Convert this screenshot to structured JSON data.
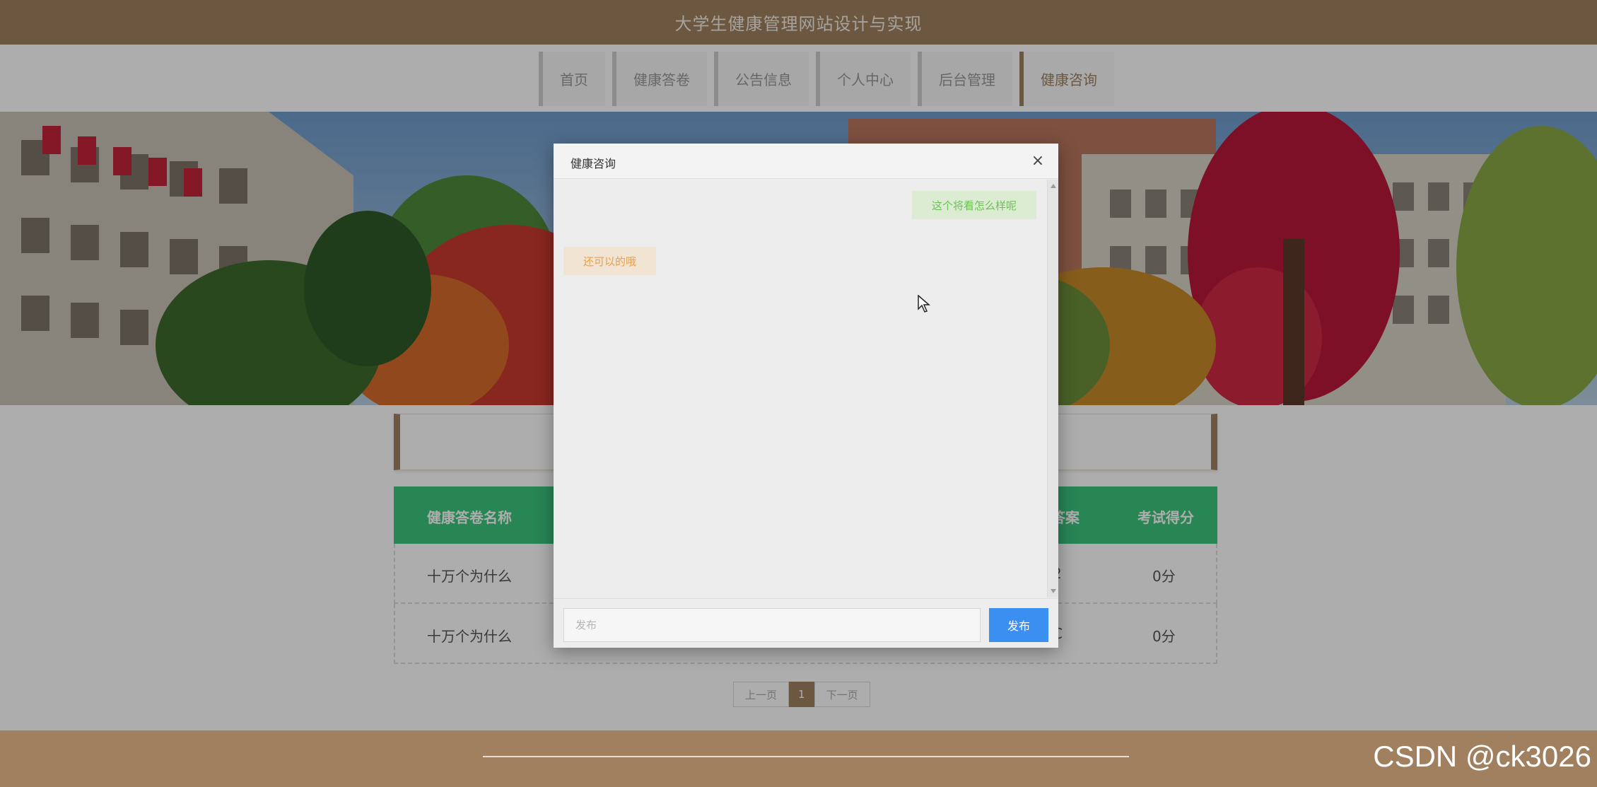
{
  "header": {
    "site_title": "大学生健康管理网站设计与实现"
  },
  "nav": {
    "items": [
      {
        "label": "首页",
        "active": false
      },
      {
        "label": "健康答卷",
        "active": false
      },
      {
        "label": "公告信息",
        "active": false
      },
      {
        "label": "个人中心",
        "active": false
      },
      {
        "label": "后台管理",
        "active": false
      },
      {
        "label": "健康咨询",
        "active": true
      }
    ]
  },
  "table": {
    "headers": {
      "name": "健康答卷名称",
      "answer": "答案",
      "score": "考试得分"
    },
    "rows": [
      {
        "name": "十万个为什么",
        "answer": "2",
        "score": "0分"
      },
      {
        "name": "十万个为什么",
        "answer": "C",
        "score": "0分"
      }
    ]
  },
  "pager": {
    "prev": "上一页",
    "current": "1",
    "next": "下一页"
  },
  "dialog": {
    "title": "健康咨询",
    "close": "×",
    "messages": {
      "sent": "这个将看怎么样呢",
      "received": "还可以的哦"
    },
    "input_placeholder": "发布",
    "send_label": "发布"
  },
  "watermark": "CSDN @ck3026",
  "colors": {
    "brand_brown": "#a0805f",
    "table_header_green": "#3cc57c",
    "send_button_blue": "#3b8ff0",
    "sent_bubble": "#dcecd2",
    "received_bubble": "#f1e4d3"
  }
}
